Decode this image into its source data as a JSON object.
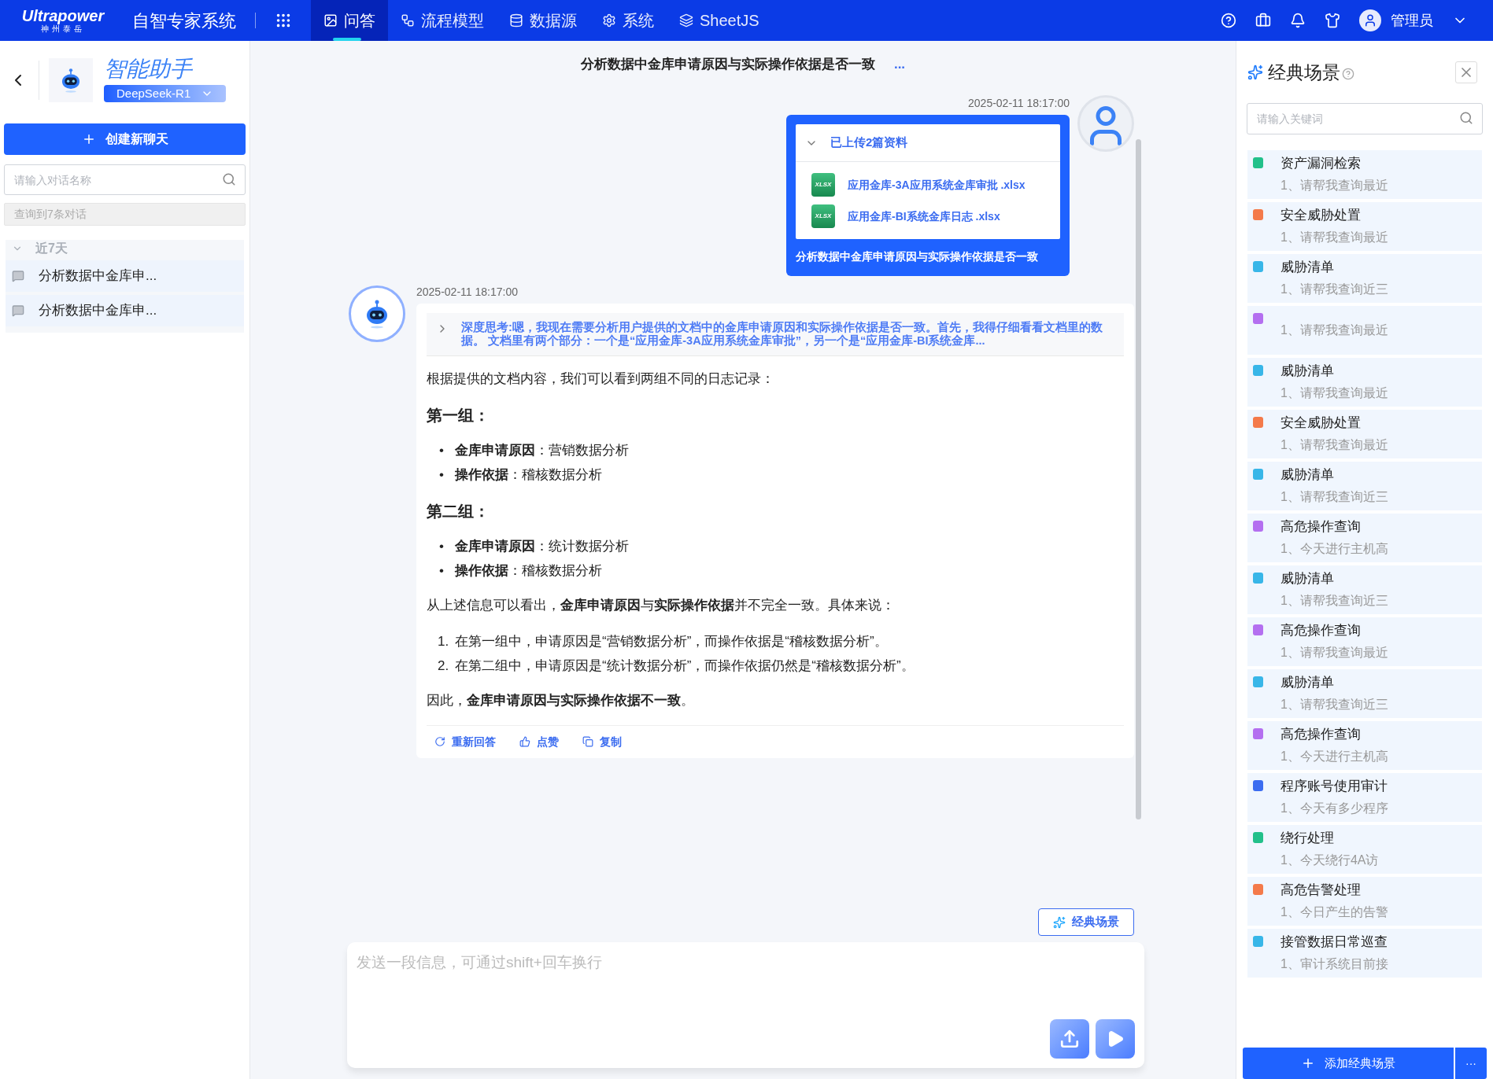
{
  "topbar": {
    "logo": "Ultrapower",
    "logo_sub": "神州泰岳",
    "system": "自智专家系统",
    "nav": [
      {
        "label": "问答",
        "kind": "qa",
        "selected": true
      },
      {
        "label": "流程模型",
        "kind": "flow",
        "selected": false
      },
      {
        "label": "数据源",
        "kind": "data",
        "selected": false
      },
      {
        "label": "系统",
        "kind": "system",
        "selected": false
      },
      {
        "label": "SheetJS",
        "kind": "sheet",
        "selected": false
      }
    ],
    "user": "管理员"
  },
  "sidebar": {
    "assistant_title": "智能助手",
    "model": "DeepSeek-R1",
    "new_chat": "创建新聊天",
    "search": {
      "placeholder": "请输入对话名称"
    },
    "result_count": "查询到7条对话",
    "groups": [
      {
        "label": "近7天",
        "expanded": true,
        "items": [
          {
            "label": "分析数据中金库申..."
          },
          {
            "label": "分析数据中金库申..."
          }
        ]
      }
    ]
  },
  "chat": {
    "title": "分析数据中金库申请原因与实际操作依据是否一致",
    "more": "...",
    "user_message": {
      "time": "2025-02-11 18:17:00",
      "attachments_label": "已上传2篇资料",
      "attachments_expanded": true,
      "files": [
        {
          "name": "应用金库-3A应用系统金库审批 .xlsx",
          "badge": "XLSX"
        },
        {
          "name": "应用金库-BI系统金库日志 .xlsx",
          "badge": "XLSX"
        }
      ],
      "text": "分析数据中金库申请原因与实际操作依据是否一致"
    },
    "bot_message": {
      "time": "2025-02-11 18:17:00",
      "thinking": "深度思考:嗯，我现在需要分析用户提供的文档中的金库申请原因和实际操作依据是否一致。首先，我得仔细看看文档里的数据。 文档里有两个部分：一个是“应用金库-3A应用系统金库审批”，另一个是“应用金库-BI系统金库...",
      "blocks": [
        {
          "kind": "p",
          "text": "根据提供的文档内容，我们可以看到两组不同的日志记录："
        },
        {
          "kind": "h",
          "text": "第一组："
        },
        {
          "kind": "ul",
          "items": [
            {
              "marker": "•",
              "text": "**金库申请原因**：营销数据分析"
            },
            {
              "marker": "•",
              "text": "**操作依据**：稽核数据分析"
            }
          ]
        },
        {
          "kind": "h",
          "text": "第二组："
        },
        {
          "kind": "ul",
          "items": [
            {
              "marker": "•",
              "text": "**金库申请原因**：统计数据分析"
            },
            {
              "marker": "•",
              "text": "**操作依据**：稽核数据分析"
            }
          ]
        },
        {
          "kind": "p",
          "text": "从上述信息可以看出，**金库申请原因**与**实际操作依据**并不完全一致。具体来说："
        },
        {
          "kind": "ol",
          "items": [
            {
              "marker": "1.",
              "text": "在第一组中，申请原因是“营销数据分析”，而操作依据是“稽核数据分析”。"
            },
            {
              "marker": "2.",
              "text": "在第二组中，申请原因是“统计数据分析”，而操作依据仍然是“稽核数据分析”。"
            }
          ]
        },
        {
          "kind": "p",
          "text": "因此，**金库申请原因与实际操作依据不一致**。"
        }
      ],
      "actions": [
        {
          "label": "重新回答",
          "kind": "retry"
        },
        {
          "label": "点赞",
          "kind": "like"
        },
        {
          "label": "复制",
          "kind": "copy"
        }
      ]
    },
    "scenes_button": "经典场景",
    "input": {
      "placeholder": "发送一段信息，可通过shift+回车换行"
    }
  },
  "scenes": {
    "title": "经典场景",
    "search": {
      "placeholder": "请输入关键词"
    },
    "items": [
      {
        "title": "资产漏洞检索",
        "desc": "1、请帮我查询最近",
        "color": "#22c08a"
      },
      {
        "title": "安全威胁处置",
        "desc": "1、请帮我查询最近",
        "color": "#f47a4a"
      },
      {
        "title": "威胁清单",
        "desc": "1、请帮我查询近三",
        "color": "#38b6e8"
      },
      {
        "desc": "1、请帮我查询最近",
        "color": "#b46ff0"
      },
      {
        "title": "威胁清单",
        "desc": "1、请帮我查询最近",
        "color": "#38b6e8"
      },
      {
        "title": "安全威胁处置",
        "desc": "1、请帮我查询最近",
        "color": "#f47a4a"
      },
      {
        "title": "威胁清单",
        "desc": "1、请帮我查询近三",
        "color": "#38b6e8"
      },
      {
        "title": "高危操作查询",
        "desc": "1、今天进行主机高",
        "color": "#b46ff0"
      },
      {
        "title": "威胁清单",
        "desc": "1、请帮我查询近三",
        "color": "#38b6e8"
      },
      {
        "title": "高危操作查询",
        "desc": "1、请帮我查询最近",
        "color": "#b46ff0"
      },
      {
        "title": "威胁清单",
        "desc": "1、请帮我查询近三",
        "color": "#38b6e8"
      },
      {
        "title": "高危操作查询",
        "desc": "1、今天进行主机高",
        "color": "#b46ff0"
      },
      {
        "title": "程序账号使用审计",
        "desc": "1、今天有多少程序",
        "color": "#3b6cf0"
      },
      {
        "title": "绕行处理",
        "desc": "1、今天绕行4A访",
        "color": "#22c08a"
      },
      {
        "title": "高危告警处理",
        "desc": "1、今日产生的告警",
        "color": "#f47a4a"
      },
      {
        "title": "接管数据日常巡查",
        "desc": "1、审计系统目前接",
        "color": "#38b6e8"
      }
    ],
    "add_button": "添加经典场景",
    "more_button": "···"
  }
}
